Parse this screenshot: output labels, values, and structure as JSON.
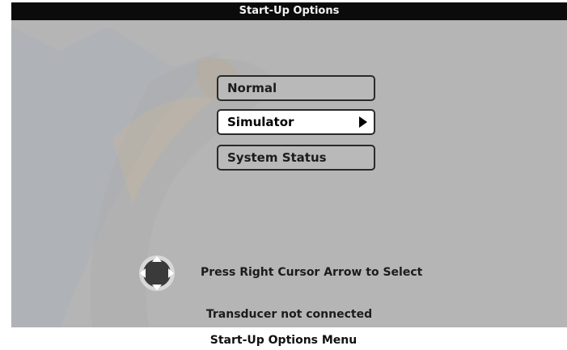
{
  "screen": {
    "title": "Start-Up Options",
    "menu_items": [
      {
        "label": "Normal",
        "selected": false
      },
      {
        "label": "Simulator",
        "selected": true
      },
      {
        "label": "System Status",
        "selected": false
      }
    ],
    "hint": "Press Right Cursor Arrow to Select",
    "status": "Transducer not connected"
  },
  "caption": "Start-Up Options Menu",
  "colors": {
    "title_bar": "#0b0b0b",
    "screen_bg": "#b5b5b5",
    "selected_item": "#ffffff"
  },
  "icons": {
    "selected_indicator": "right-arrow-icon",
    "cursor_pad": "cursor-pad-icon"
  }
}
